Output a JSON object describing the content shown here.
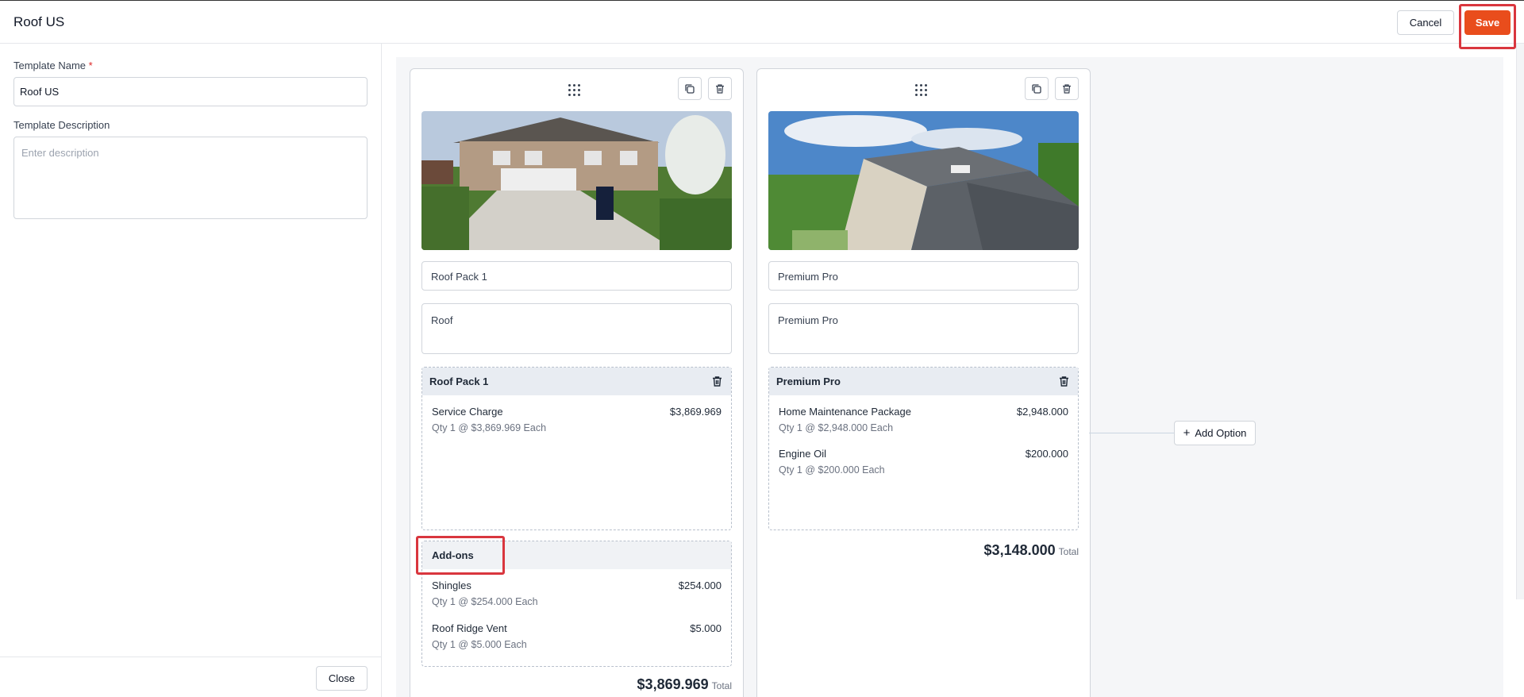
{
  "header": {
    "title": "Roof US",
    "cancel_label": "Cancel",
    "save_label": "Save"
  },
  "form": {
    "name_label": "Template Name",
    "required_mark": "*",
    "name_value": "Roof US",
    "desc_label": "Template Description",
    "desc_placeholder": "Enter description",
    "close_label": "Close"
  },
  "options": [
    {
      "title": "Roof Pack 1",
      "description": "Roof",
      "group_title": "Roof Pack 1",
      "items": [
        {
          "name": "Service Charge",
          "amount": "$3,869.969",
          "detail": "Qty 1 @ $3,869.969 Each"
        }
      ],
      "addons_title": "Add-ons",
      "addons": [
        {
          "name": "Shingles",
          "amount": "$254.000",
          "detail": "Qty 1 @ $254.000 Each"
        },
        {
          "name": "Roof Ridge Vent",
          "amount": "$5.000",
          "detail": "Qty 1 @ $5.000 Each"
        }
      ],
      "total": "$3,869.969",
      "total_label": "Total"
    },
    {
      "title": "Premium Pro",
      "description": "Premium Pro",
      "group_title": "Premium Pro",
      "items": [
        {
          "name": "Home Maintenance Package",
          "amount": "$2,948.000",
          "detail": "Qty 1 @ $2,948.000 Each"
        },
        {
          "name": "Engine Oil",
          "amount": "$200.000",
          "detail": "Qty 1 @ $200.000 Each"
        }
      ],
      "total": "$3,148.000",
      "total_label": "Total"
    }
  ],
  "add_option_label": "Add Option",
  "colors": {
    "accent": "#e94d1c",
    "highlight": "#d9363e"
  }
}
